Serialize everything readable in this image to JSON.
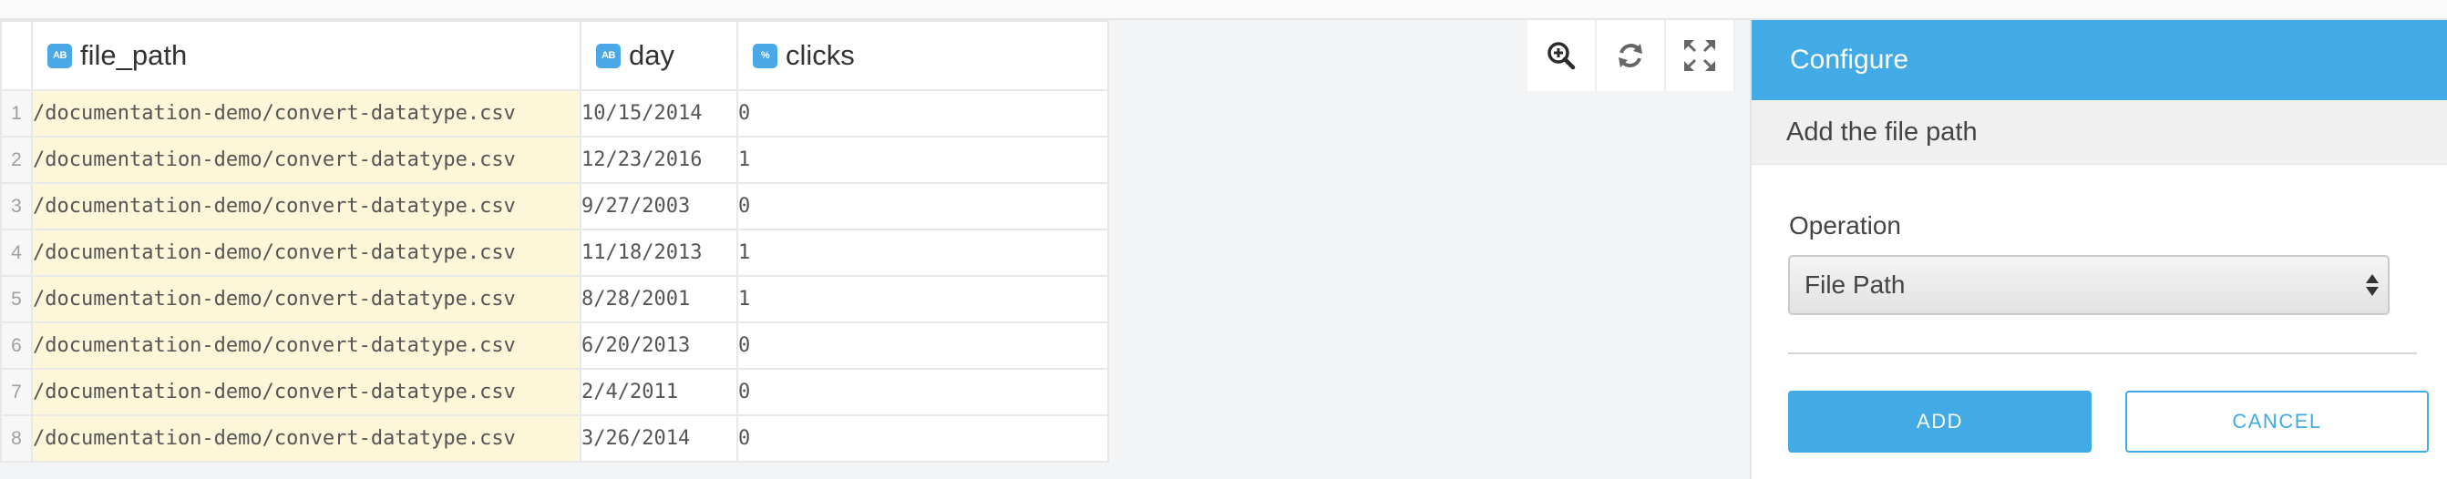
{
  "grid": {
    "columns": [
      {
        "name": "file_path",
        "type_icon": "AB"
      },
      {
        "name": "day",
        "type_icon": "AB"
      },
      {
        "name": "clicks",
        "type_icon": "%"
      }
    ],
    "rows": [
      {
        "num": "1",
        "file_path": "/documentation-demo/convert-datatype.csv",
        "day": "10/15/2014",
        "clicks": "0"
      },
      {
        "num": "2",
        "file_path": "/documentation-demo/convert-datatype.csv",
        "day": "12/23/2016",
        "clicks": "1"
      },
      {
        "num": "3",
        "file_path": "/documentation-demo/convert-datatype.csv",
        "day": "9/27/2003",
        "clicks": "0"
      },
      {
        "num": "4",
        "file_path": "/documentation-demo/convert-datatype.csv",
        "day": "11/18/2013",
        "clicks": "1"
      },
      {
        "num": "5",
        "file_path": "/documentation-demo/convert-datatype.csv",
        "day": "8/28/2001",
        "clicks": "1"
      },
      {
        "num": "6",
        "file_path": "/documentation-demo/convert-datatype.csv",
        "day": "6/20/2013",
        "clicks": "0"
      },
      {
        "num": "7",
        "file_path": "/documentation-demo/convert-datatype.csv",
        "day": "2/4/2011",
        "clicks": "0"
      },
      {
        "num": "8",
        "file_path": "/documentation-demo/convert-datatype.csv",
        "day": "3/26/2014",
        "clicks": "0"
      }
    ]
  },
  "toolbar": {
    "icons": [
      "zoom-in-icon",
      "refresh-icon",
      "fullscreen-icon"
    ]
  },
  "panel": {
    "title": "Configure",
    "subtitle": "Add the file path",
    "operation_label": "Operation",
    "operation_value": "File Path",
    "add_label": "ADD",
    "cancel_label": "CANCEL"
  },
  "colors": {
    "accent": "#42abe5",
    "highlight_column": "#fdf6d8"
  }
}
